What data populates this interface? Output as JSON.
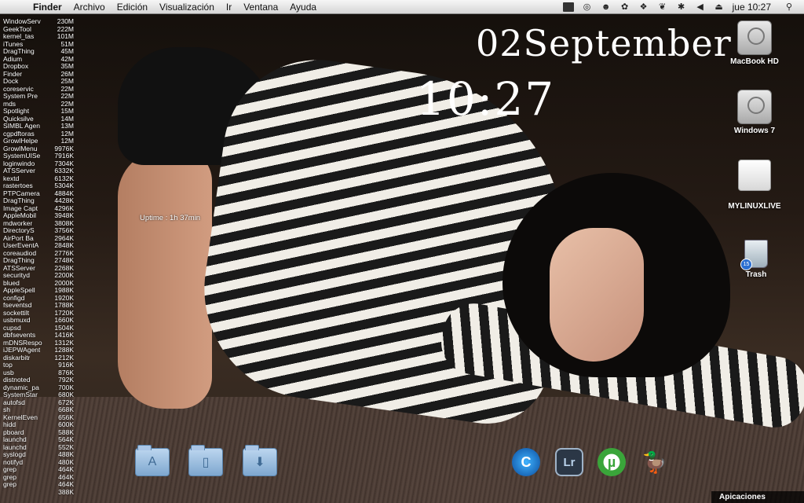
{
  "menubar": {
    "app_name": "Finder",
    "items": [
      "Archivo",
      "Edición",
      "Visualización",
      "Ir",
      "Ventana",
      "Ayuda"
    ],
    "clock": "jue 10:27"
  },
  "process_list": [
    {
      "name": "WindowServ",
      "mem": "230M"
    },
    {
      "name": "GeekTool",
      "mem": "222M"
    },
    {
      "name": "kernel_tas",
      "mem": "101M"
    },
    {
      "name": "iTunes",
      "mem": "51M"
    },
    {
      "name": "DragThing",
      "mem": "45M"
    },
    {
      "name": "Adium",
      "mem": "42M"
    },
    {
      "name": "Dropbox",
      "mem": "35M"
    },
    {
      "name": "Finder",
      "mem": "26M"
    },
    {
      "name": "Dock",
      "mem": "25M"
    },
    {
      "name": "coreservic",
      "mem": "22M"
    },
    {
      "name": "System Pre",
      "mem": "22M"
    },
    {
      "name": "mds",
      "mem": "22M"
    },
    {
      "name": "Spotlight",
      "mem": "15M"
    },
    {
      "name": "Quicksilve",
      "mem": "14M"
    },
    {
      "name": "SIMBL Agen",
      "mem": "13M"
    },
    {
      "name": "cgpdftoras",
      "mem": "12M"
    },
    {
      "name": "GrowlHelpe",
      "mem": "12M"
    },
    {
      "name": "GrowlMenu",
      "mem": "9976K"
    },
    {
      "name": "SystemUISe",
      "mem": "7916K"
    },
    {
      "name": "loginwindo",
      "mem": "7304K"
    },
    {
      "name": "ATSServer",
      "mem": "6332K"
    },
    {
      "name": "kextd",
      "mem": "6132K"
    },
    {
      "name": "rastertoes",
      "mem": "5304K"
    },
    {
      "name": "PTPCamera",
      "mem": "4884K"
    },
    {
      "name": "DragThing",
      "mem": "4428K"
    },
    {
      "name": "Image Capt",
      "mem": "4296K"
    },
    {
      "name": "AppleMobil",
      "mem": "3948K"
    },
    {
      "name": "mdworker",
      "mem": "3808K"
    },
    {
      "name": "DirectoryS",
      "mem": "3756K"
    },
    {
      "name": "AirPort Ba",
      "mem": "2964K"
    },
    {
      "name": "UserEventA",
      "mem": "2848K"
    },
    {
      "name": "coreaudiod",
      "mem": "2776K"
    },
    {
      "name": "DragThing",
      "mem": "2748K"
    },
    {
      "name": "ATSServer",
      "mem": "2268K"
    },
    {
      "name": "securityd",
      "mem": "2200K"
    },
    {
      "name": "blued",
      "mem": "2000K"
    },
    {
      "name": "AppleSpell",
      "mem": "1988K"
    },
    {
      "name": "configd",
      "mem": "1920K"
    },
    {
      "name": "fseventsd",
      "mem": "1788K"
    },
    {
      "name": "sockettilt",
      "mem": "1720K"
    },
    {
      "name": "usbmuxd",
      "mem": "1660K"
    },
    {
      "name": "cupsd",
      "mem": "1504K"
    },
    {
      "name": "dbfsevents",
      "mem": "1416K"
    },
    {
      "name": "mDNSRespon",
      "mem": "1312K"
    },
    {
      "name": "iJEPWAgent",
      "mem": "1288K"
    },
    {
      "name": "diskarbitr",
      "mem": "1212K"
    },
    {
      "name": "top",
      "mem": "916K"
    },
    {
      "name": "usb",
      "mem": "876K"
    },
    {
      "name": "distnoted",
      "mem": "792K"
    },
    {
      "name": "dynamic_pa",
      "mem": "700K"
    },
    {
      "name": "SystemStar",
      "mem": "680K"
    },
    {
      "name": "autofsd",
      "mem": "672K"
    },
    {
      "name": "sh",
      "mem": "668K"
    },
    {
      "name": "KernelEven",
      "mem": "656K"
    },
    {
      "name": "hidd",
      "mem": "600K"
    },
    {
      "name": "pboard",
      "mem": "588K"
    },
    {
      "name": "launchd",
      "mem": "564K"
    },
    {
      "name": "launchd",
      "mem": "552K"
    },
    {
      "name": "syslogd",
      "mem": "488K"
    },
    {
      "name": "notifyd",
      "mem": "480K"
    },
    {
      "name": "grep",
      "mem": "464K"
    },
    {
      "name": "grep",
      "mem": "464K"
    },
    {
      "name": "grep",
      "mem": "464K"
    },
    {
      "name": "",
      "mem": "388K"
    }
  ],
  "uptime": "Uptime : 1h 37min",
  "desktop_clock": {
    "date": "02September",
    "time": "10:27"
  },
  "desktop_icons": {
    "macbook_hd": "MacBook HD",
    "windows7": "Windows 7",
    "mylinuxlive": "MYLINUXLIVE",
    "trash": "Trash",
    "trash_badge": "15"
  },
  "dock": {
    "folders": [
      {
        "name": "applications-folder-icon"
      },
      {
        "name": "documents-folder-icon"
      },
      {
        "name": "downloads-folder-icon"
      }
    ],
    "apps": [
      {
        "name": "camino-icon",
        "glyph": "C"
      },
      {
        "name": "lightroom-icon",
        "glyph": "Lr"
      },
      {
        "name": "utorrent-icon",
        "glyph": "µ"
      },
      {
        "name": "cyberduck-icon",
        "glyph": "🦆"
      }
    ],
    "stack_label": "Apicaciones"
  }
}
